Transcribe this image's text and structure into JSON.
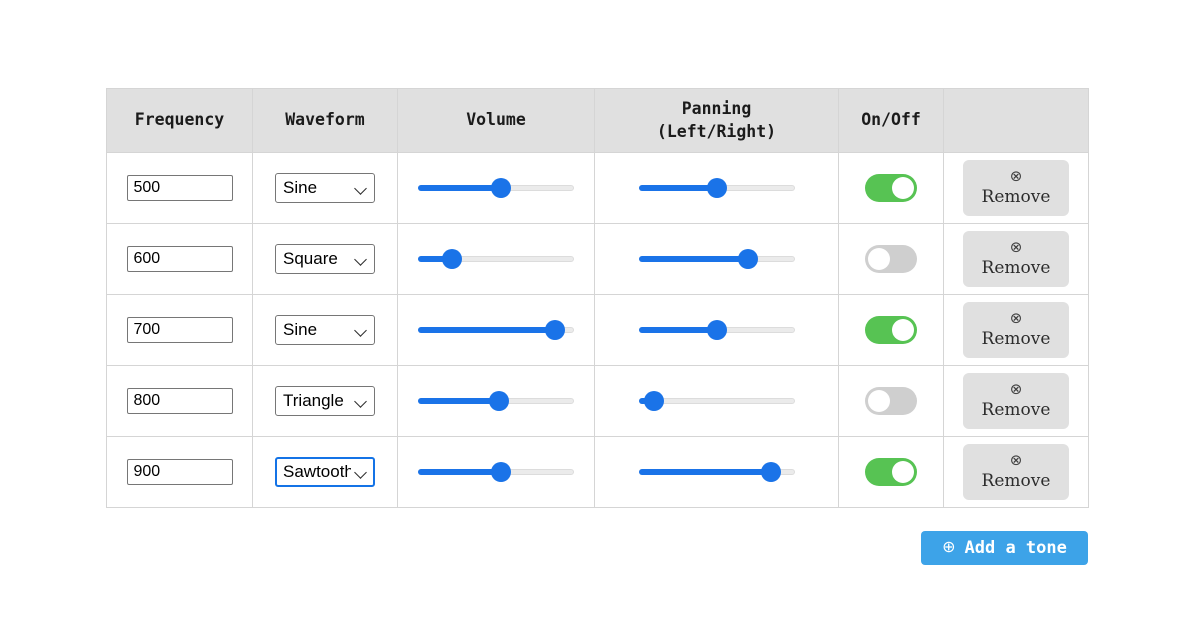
{
  "table": {
    "columns": [
      {
        "id": "frequency",
        "label": "Frequency"
      },
      {
        "id": "waveform",
        "label": "Waveform"
      },
      {
        "id": "volume",
        "label": "Volume"
      },
      {
        "id": "panning",
        "label": "Panning\n(Left/Right)",
        "label_line1": "Panning",
        "label_line2": "(Left/Right)"
      },
      {
        "id": "onoff",
        "label": "On/Off"
      },
      {
        "id": "actions",
        "label": ""
      }
    ],
    "rows": [
      {
        "frequency": "500",
        "waveform": "Sine",
        "volume": 53,
        "panning": 50,
        "on": true,
        "remove_icon": "circle-x-icon",
        "remove_label": "Remove",
        "waveform_focused": false
      },
      {
        "frequency": "600",
        "waveform": "Square",
        "volume": 22,
        "panning": 70,
        "on": false,
        "remove_icon": "circle-x-icon",
        "remove_label": "Remove",
        "waveform_focused": false
      },
      {
        "frequency": "700",
        "waveform": "Sine",
        "volume": 88,
        "panning": 50,
        "on": true,
        "remove_icon": "circle-x-icon",
        "remove_label": "Remove",
        "waveform_focused": false
      },
      {
        "frequency": "800",
        "waveform": "Triangle",
        "volume": 52,
        "panning": 10,
        "on": false,
        "remove_icon": "circle-x-icon",
        "remove_label": "Remove",
        "waveform_focused": false
      },
      {
        "frequency": "900",
        "waveform": "Sawtooth",
        "volume": 53,
        "panning": 85,
        "on": true,
        "remove_icon": "circle-x-icon",
        "remove_label": "Remove",
        "waveform_focused": true
      }
    ]
  },
  "waveform_options": [
    "Sine",
    "Square",
    "Triangle",
    "Sawtooth"
  ],
  "add_button": {
    "label": "Add a tone",
    "icon": "circle-plus-icon"
  },
  "icons": {
    "circle_x": "⊗",
    "circle_plus": "⊕"
  },
  "colors": {
    "accent_blue": "#1a73e8",
    "add_button_blue": "#3da3e8",
    "toggle_on_green": "#57c353",
    "toggle_off_gray": "#cfcfcf",
    "header_gray": "#e0e0e0",
    "border_gray": "#d5d5d5"
  }
}
